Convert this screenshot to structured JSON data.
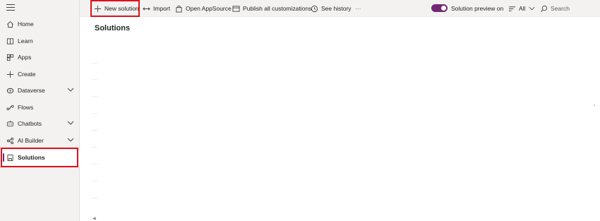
{
  "sidebar": {
    "items": [
      {
        "label": "Home",
        "icon": "home-icon"
      },
      {
        "label": "Learn",
        "icon": "book-icon"
      },
      {
        "label": "Apps",
        "icon": "apps-icon"
      },
      {
        "label": "Create",
        "icon": "plus-icon"
      },
      {
        "label": "Dataverse",
        "icon": "dataverse-icon"
      },
      {
        "label": "Flows",
        "icon": "flows-icon"
      },
      {
        "label": "Chatbots",
        "icon": "chatbot-icon"
      },
      {
        "label": "AI Builder",
        "icon": "ai-builder-icon"
      },
      {
        "label": "Solutions",
        "icon": "solutions-icon"
      }
    ],
    "selected": "Solutions"
  },
  "toolbar": {
    "new_solution": "New solution",
    "import": "Import",
    "open_appsource": "Open AppSource",
    "publish_all": "Publish all customizations",
    "see_history": "See history",
    "more": "···",
    "solution_preview": "Solution preview on",
    "filter": "All",
    "search_placeholder": "Search"
  },
  "main": {
    "title": "Solutions"
  },
  "colors": {
    "accent": "#742774",
    "highlight_box": "#e0101a",
    "sidebar_bg": "#f3f2f1"
  }
}
